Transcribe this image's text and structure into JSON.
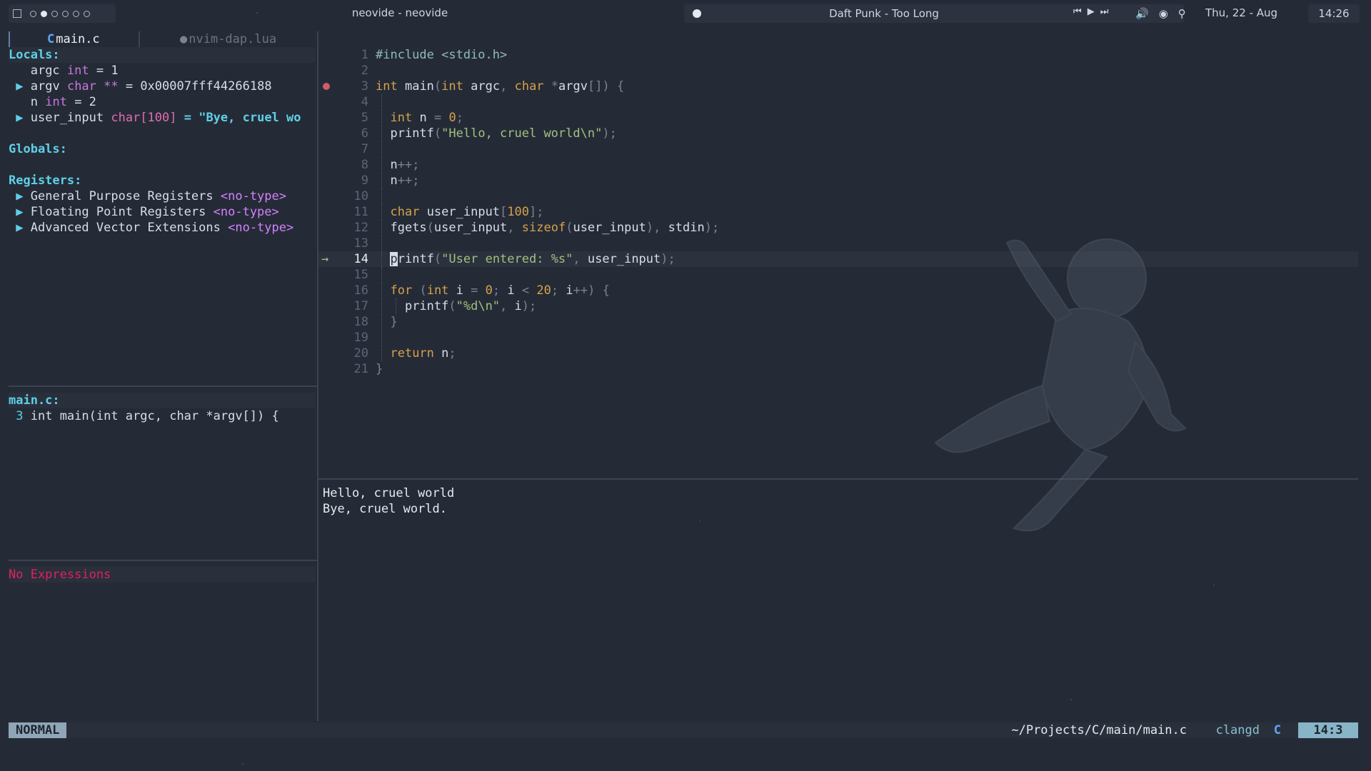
{
  "topbar": {
    "window_title": "neovide - neovide",
    "track": "Daft Punk - Too Long",
    "date": "Thu, 22 - Aug",
    "time": "14:26"
  },
  "tabs": [
    {
      "label": "main.c",
      "active": true
    },
    {
      "label": "nvim-dap.lua",
      "active": false
    }
  ],
  "scopes": {
    "locals_header": "Locals",
    "locals": [
      {
        "name": "argc",
        "type": "int",
        "value": "= 1",
        "expandable": false
      },
      {
        "name": "argv",
        "type": "char **",
        "value": "= 0x00007fff44266188",
        "expandable": true
      },
      {
        "name": "n",
        "type": "int",
        "value": "= 2",
        "expandable": false
      },
      {
        "name": "user_input",
        "type": "char[100]",
        "value": "= \"Bye, cruel wo",
        "expandable": true
      }
    ],
    "globals_header": "Globals",
    "registers_header": "Registers",
    "registers": [
      {
        "name": "General Purpose Registers",
        "type": "<no-type>"
      },
      {
        "name": "Floating Point Registers",
        "type": "<no-type>"
      },
      {
        "name": "Advanced Vector Extensions",
        "type": "<no-type>"
      }
    ]
  },
  "breakpoints": {
    "file": "main.c",
    "entries": [
      {
        "line": "3",
        "text": "int main(int argc, char *argv[]) {"
      }
    ]
  },
  "watches": {
    "empty_text": "No Expressions"
  },
  "code": {
    "current_line": 14,
    "breakpoint_line": 3,
    "lines": [
      "#include <stdio.h>",
      "",
      "int main(int argc, char *argv[]) {",
      "",
      "  int n = 0;",
      "  printf(\"Hello, cruel world\\n\");",
      "",
      "  n++;",
      "  n++;",
      "",
      "  char user_input[100];",
      "  fgets(user_input, sizeof(user_input), stdin);",
      "",
      "  printf(\"User entered: %s\", user_input);",
      "",
      "  for (int i = 0; i < 20; i++) {",
      "    printf(\"%d\\n\", i);",
      "  }",
      "",
      "  return n;",
      "}"
    ]
  },
  "terminal": {
    "lines": [
      "Hello, cruel world",
      "Bye, cruel world."
    ]
  },
  "statusline": {
    "mode": "NORMAL",
    "path": "~/Projects/C/main/main.c",
    "lsp": "clangd",
    "position": "14:3"
  },
  "colors": {
    "background": "#252b36",
    "accent": "#5ed0e8",
    "breakpoint": "#d05a6e",
    "error": "#e0205f"
  }
}
